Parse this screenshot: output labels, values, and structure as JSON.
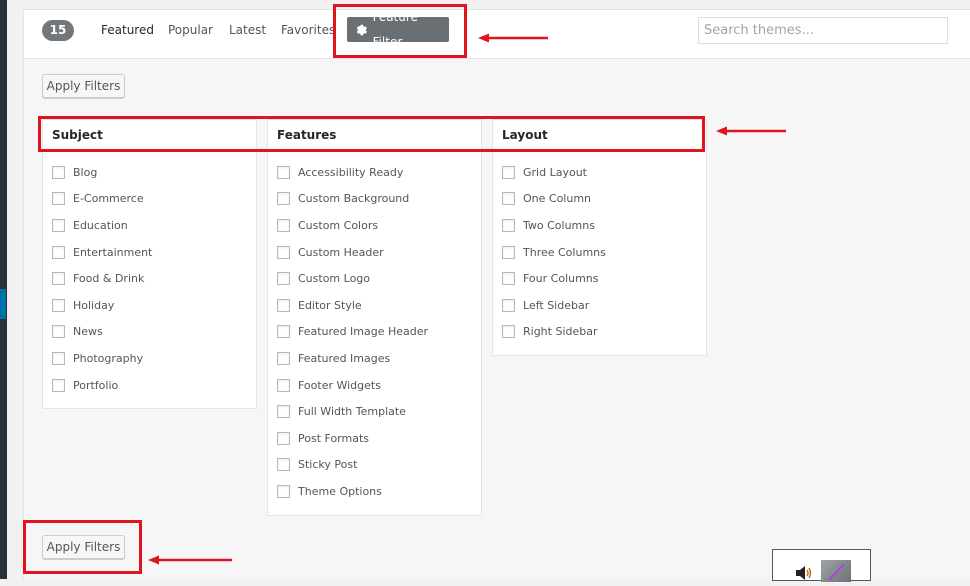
{
  "header": {
    "count": "15",
    "tabs": [
      {
        "label": "Featured",
        "active": true
      },
      {
        "label": "Popular"
      },
      {
        "label": "Latest"
      },
      {
        "label": "Favorites"
      }
    ],
    "feature_filter_label": "Feature Filter",
    "feature_filter_icon": "gear-icon",
    "search_placeholder": "Search themes..."
  },
  "apply_filters_label": "Apply Filters",
  "filter_groups": [
    {
      "title": "Subject",
      "items": [
        "Blog",
        "E-Commerce",
        "Education",
        "Entertainment",
        "Food & Drink",
        "Holiday",
        "News",
        "Photography",
        "Portfolio"
      ]
    },
    {
      "title": "Features",
      "items": [
        "Accessibility Ready",
        "Custom Background",
        "Custom Colors",
        "Custom Header",
        "Custom Logo",
        "Editor Style",
        "Featured Image Header",
        "Featured Images",
        "Footer Widgets",
        "Full Width Template",
        "Post Formats",
        "Sticky Post",
        "Theme Options"
      ]
    },
    {
      "title": "Layout",
      "items": [
        "Grid Layout",
        "One Column",
        "Two Columns",
        "Three Columns",
        "Four Columns",
        "Left Sidebar",
        "Right Sidebar"
      ]
    }
  ],
  "colors": {
    "annotation_red": "#e0141e",
    "count_badge": "#72777c",
    "feature_filter_bg": "#6a6f74"
  }
}
